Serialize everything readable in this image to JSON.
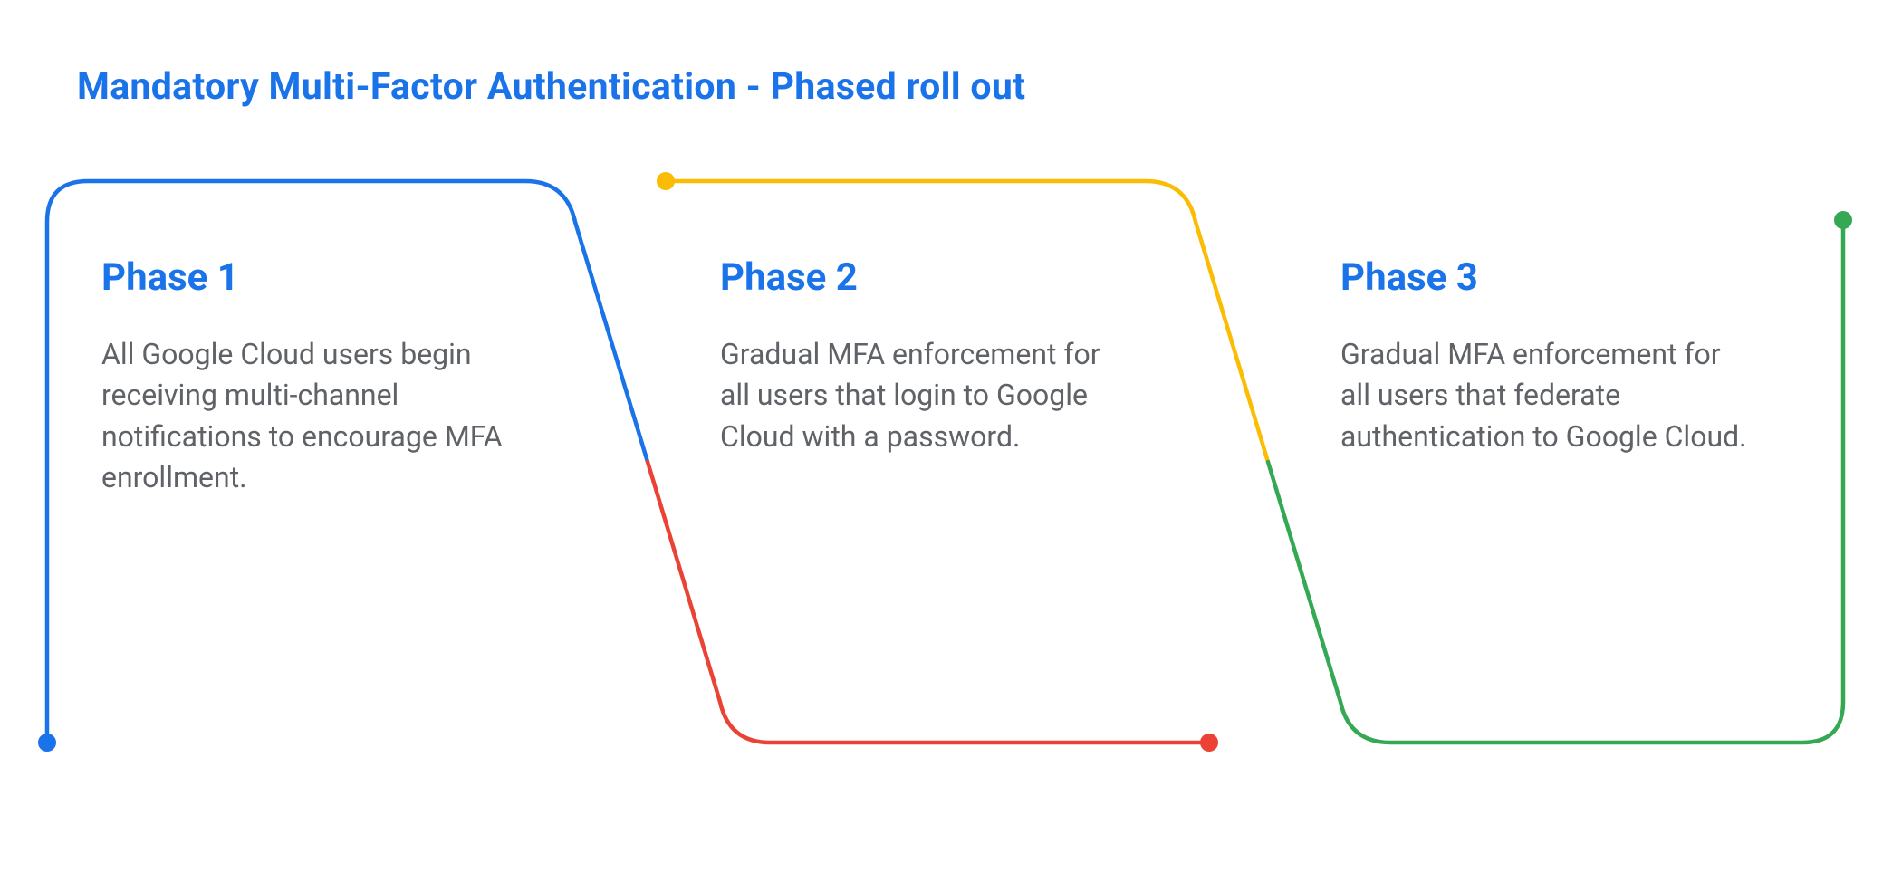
{
  "colors": {
    "blue": "#1a73e8",
    "red": "#ea4335",
    "yellow": "#fbbc04",
    "green": "#34a853",
    "grey": "#5f6368"
  },
  "title": "Mandatory Multi-Factor Authentication - Phased roll out",
  "phases": [
    {
      "name": "Phase 1",
      "body": "All Google Cloud users begin receiving multi-channel notifications to encourage MFA enrollment."
    },
    {
      "name": "Phase 2",
      "body": "Gradual MFA enforcement for all users that login to Google Cloud with a password."
    },
    {
      "name": "Phase 3",
      "body": "Gradual MFA enforcement for all users that federate authentication to Google Cloud."
    }
  ]
}
